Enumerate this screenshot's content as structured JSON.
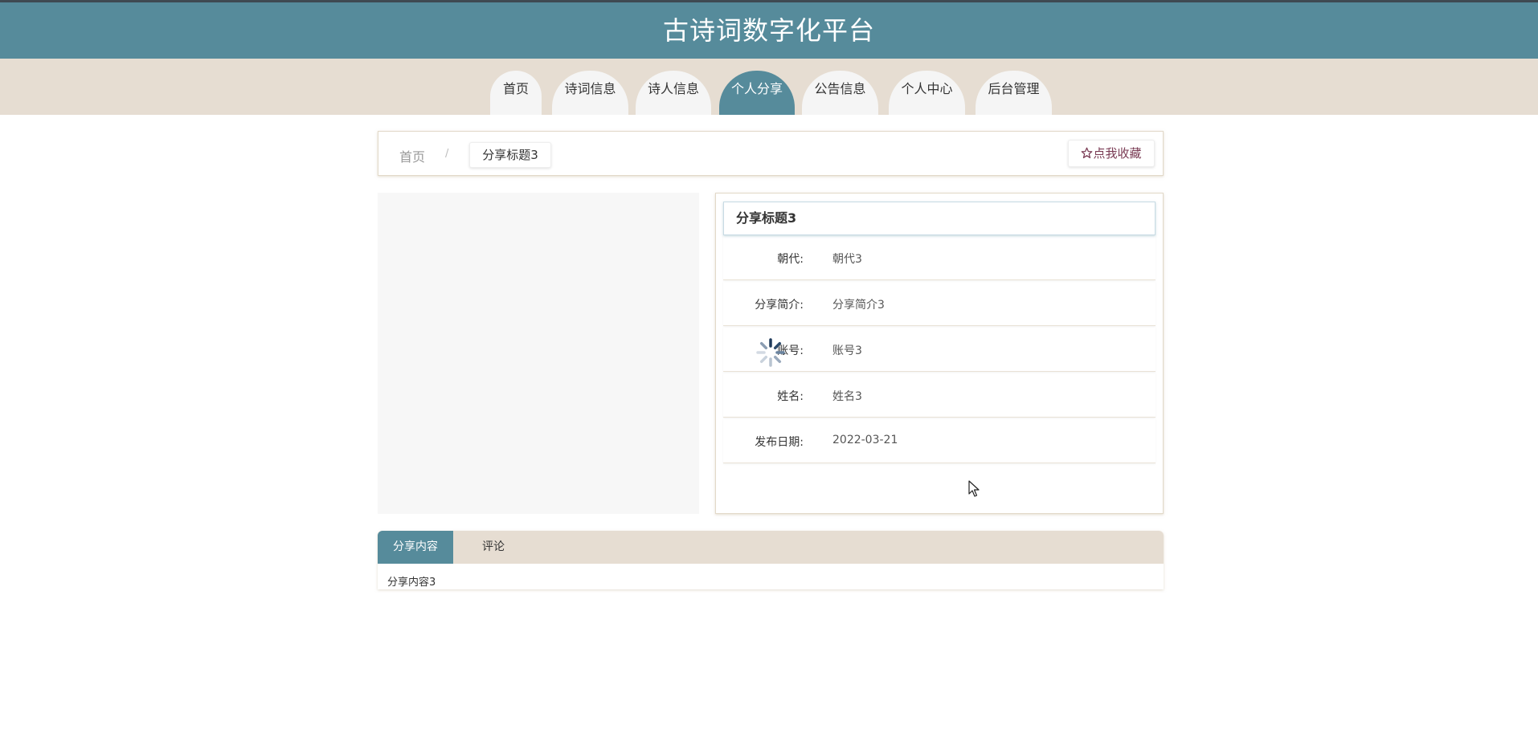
{
  "header": {
    "title": "古诗词数字化平台"
  },
  "nav": {
    "items": [
      {
        "label": "首页"
      },
      {
        "label": "诗词信息"
      },
      {
        "label": "诗人信息"
      },
      {
        "label": "个人分享"
      },
      {
        "label": "公告信息"
      },
      {
        "label": "个人中心"
      },
      {
        "label": "后台管理"
      }
    ],
    "active": "个人分享"
  },
  "breadcrumb": {
    "home": "首页",
    "separator": "/",
    "current": "分享标题3"
  },
  "favorite": {
    "icon": "star-outline-icon",
    "label": "点我收藏"
  },
  "detail": {
    "title": "分享标题3",
    "rows": [
      {
        "label": "朝代:",
        "value": "朝代3"
      },
      {
        "label": "分享简介:",
        "value": "分享简介3"
      },
      {
        "label": "账号:",
        "value": "账号3"
      },
      {
        "label": "姓名:",
        "value": "姓名3"
      },
      {
        "label": "发布日期:",
        "value": "2022-03-21"
      }
    ]
  },
  "tabs": {
    "items": [
      {
        "label": "分享内容"
      },
      {
        "label": "评论"
      }
    ],
    "active": "分享内容",
    "content": "分享内容3"
  },
  "colors": {
    "header": "#568b9b",
    "navbar": "#e6ddd2",
    "active": "#568b9b",
    "favorite_text": "#7a3b54"
  }
}
